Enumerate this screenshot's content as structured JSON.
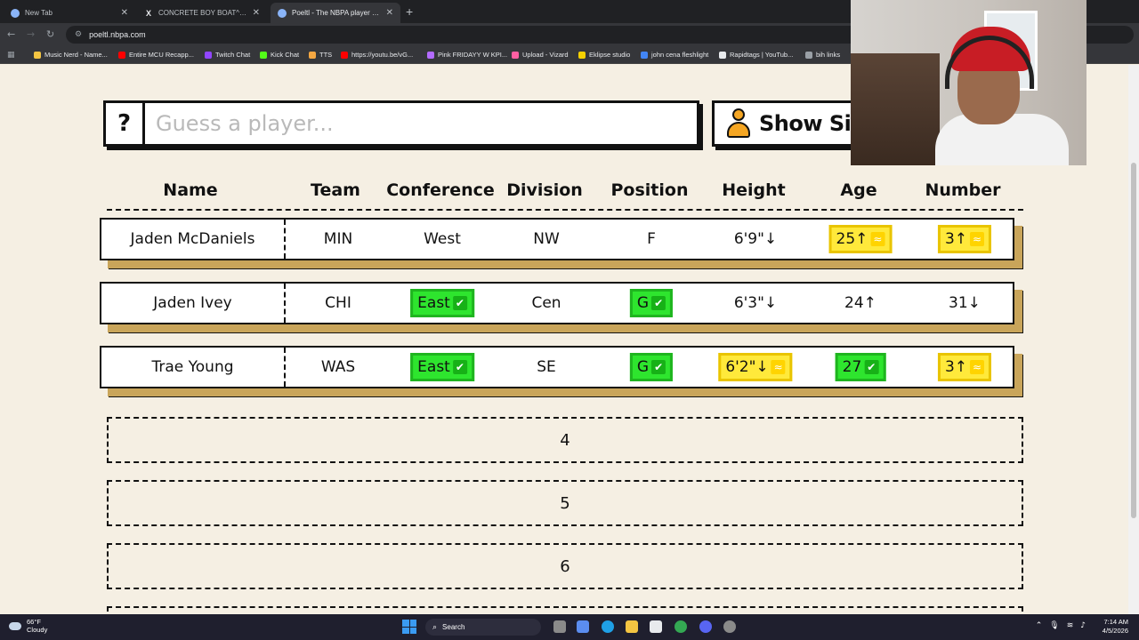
{
  "browser": {
    "tabs": [
      {
        "title": "New Tab",
        "favicon": "globe-icon"
      },
      {
        "title": "CONCRETE BOY BOAT^ on X: \"...",
        "favicon": "x-logo-icon"
      },
      {
        "title": "Poeltl - The NBPA player guessi...",
        "favicon": "globe-icon",
        "active": true
      }
    ],
    "url": "poeltl.nbpa.com",
    "bookmarks": [
      {
        "label": "Music Nerd - Name...",
        "color": "#f4c542"
      },
      {
        "label": "Entire MCU Recapp...",
        "color": "#ff0000"
      },
      {
        "label": "Twitch Chat",
        "color": "#9146ff"
      },
      {
        "label": "Kick Chat",
        "color": "#53fc18"
      },
      {
        "label": "TTS",
        "color": "#f4a742"
      },
      {
        "label": "https://youtu.be/vG...",
        "color": "#ff0000"
      },
      {
        "label": "Pink FRIDAYY W KPI...",
        "color": "#b36bff"
      },
      {
        "label": "Upload - Vizard",
        "color": "#ff5fa2"
      },
      {
        "label": "Eklipse studio",
        "color": "#f5d000"
      },
      {
        "label": "john cena fleshlight",
        "color": "#4285f4"
      },
      {
        "label": "Rapidtags | YouTub...",
        "color": "#e8eaed"
      },
      {
        "label": "bih links",
        "color": "#9aa0a6"
      }
    ]
  },
  "game": {
    "help_label": "?",
    "guess_placeholder": "Guess a player...",
    "silhouette_label": "Show Silhou",
    "headers": [
      "Name",
      "Team",
      "Conference",
      "Division",
      "Position",
      "Height",
      "Age",
      "Number"
    ],
    "guesses": [
      {
        "name": "Jaden McDaniels",
        "team": {
          "text": "MIN",
          "status": "none"
        },
        "conference": {
          "text": "West",
          "status": "none"
        },
        "division": {
          "text": "NW",
          "status": "none"
        },
        "position": {
          "text": "F",
          "status": "none"
        },
        "height": {
          "text": "6'9\"↓",
          "status": "none"
        },
        "age": {
          "text": "25↑",
          "status": "close"
        },
        "number": {
          "text": "3↑",
          "status": "close"
        }
      },
      {
        "name": "Jaden Ivey",
        "team": {
          "text": "CHI",
          "status": "none"
        },
        "conference": {
          "text": "East",
          "status": "correct"
        },
        "division": {
          "text": "Cen",
          "status": "none"
        },
        "position": {
          "text": "G",
          "status": "correct"
        },
        "height": {
          "text": "6'3\"↓",
          "status": "none"
        },
        "age": {
          "text": "24↑",
          "status": "none"
        },
        "number": {
          "text": "31↓",
          "status": "none"
        }
      },
      {
        "name": "Trae Young",
        "team": {
          "text": "WAS",
          "status": "none"
        },
        "conference": {
          "text": "East",
          "status": "correct"
        },
        "division": {
          "text": "SE",
          "status": "none"
        },
        "position": {
          "text": "G",
          "status": "correct"
        },
        "height": {
          "text": "6'2\"↓",
          "status": "close"
        },
        "age": {
          "text": "27",
          "status": "correct"
        },
        "number": {
          "text": "3↑",
          "status": "close"
        }
      }
    ],
    "empty_slots": [
      "4",
      "5",
      "6"
    ],
    "colors": {
      "correct": "#2ee52e",
      "close": "#ffe93b",
      "row_shadow": "#c9a55a"
    }
  },
  "taskbar": {
    "weather_temp": "66°F",
    "weather_desc": "Cloudy",
    "search_label": "Search",
    "time": "7:14 AM",
    "date": "4/5/2026"
  }
}
